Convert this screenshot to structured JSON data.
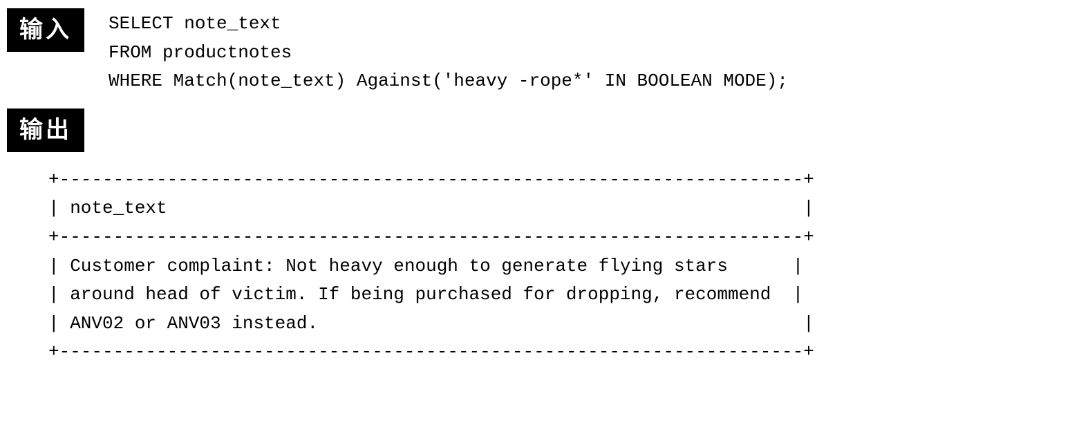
{
  "input": {
    "label": "输入",
    "code": "SELECT note_text\nFROM productnotes\nWHERE Match(note_text) Against('heavy -rope*' IN BOOLEAN MODE);"
  },
  "output": {
    "label": "输出",
    "table": "+---------------------------------------------------------------------+\n| note_text                                                           |\n+---------------------------------------------------------------------+\n| Customer complaint: Not heavy enough to generate flying stars      |\n| around head of victim. If being purchased for dropping, recommend  |\n| ANV02 or ANV03 instead.                                             |\n+---------------------------------------------------------------------+"
  }
}
